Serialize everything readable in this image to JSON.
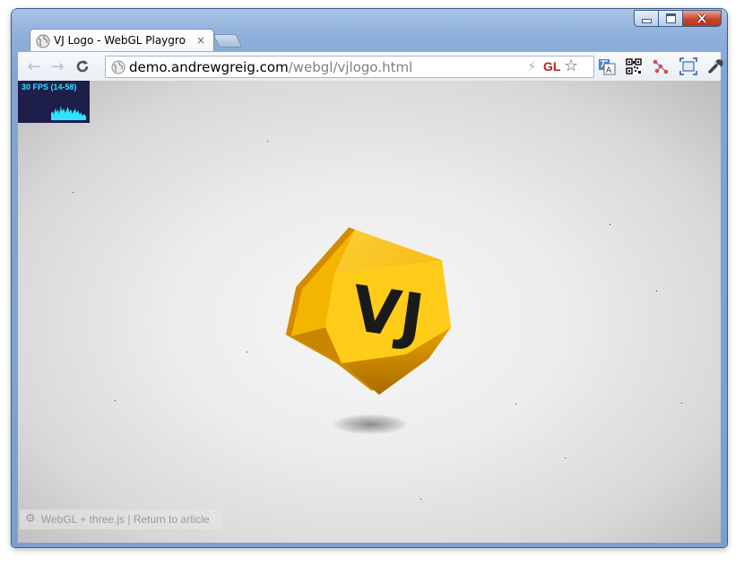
{
  "window": {
    "controls": [
      "minimize-icon",
      "maximize-icon",
      "close-icon"
    ]
  },
  "tabs": [
    {
      "title": "VJ Logo - WebGL Playgrour",
      "close": "×",
      "icon": "globe-icon"
    }
  ],
  "toolbar": {
    "back_icon": "←",
    "forward_icon": "→",
    "reload_icon": "C"
  },
  "omnibox": {
    "host": "demo.andrewgreig.com",
    "path": "/webgl/vjlogo.html",
    "gl_badge": "GL",
    "bolt": "⚡",
    "star": "☆"
  },
  "extensions": [
    "translate-icon",
    "qr-code-icon",
    "graph-icon",
    "fullscreen-icon",
    "wrench-icon"
  ],
  "stats": {
    "label": "30 FPS (14-58)",
    "color": "#2fe3ff",
    "background": "#1e1e4a"
  },
  "logo": {
    "text": "VJ",
    "color": "#f5b400"
  },
  "footer": {
    "gear": "⚙",
    "text": "WebGL + three.js | Return to article"
  }
}
